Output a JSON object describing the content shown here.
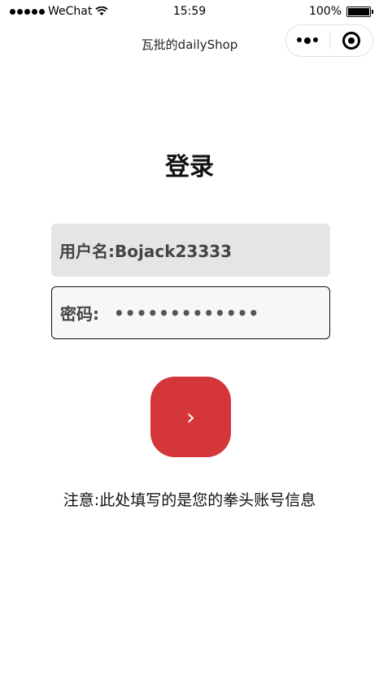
{
  "status_bar": {
    "carrier": "WeChat",
    "time": "15:59",
    "battery": "100%"
  },
  "nav": {
    "title": "瓦批的dailyShop"
  },
  "login": {
    "heading": "登录",
    "username_text": "用户名:Bojack23333",
    "password_label": "密码:",
    "password_mask": "•••••••••••••",
    "submit_glyph": "›",
    "note": "注意:此处填写的是您的拳头账号信息"
  },
  "colors": {
    "accent": "#d4363a",
    "username_bg": "#e5e5e5",
    "password_bg": "#f7f7f7"
  },
  "icons": {
    "signal": "signal-dots-icon",
    "wifi": "wifi-icon",
    "battery": "battery-icon",
    "more": "more-dots-icon",
    "close": "target-close-icon",
    "submit": "chevron-right-icon"
  }
}
